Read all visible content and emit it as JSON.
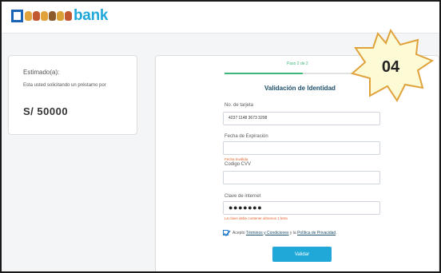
{
  "header": {
    "brand": "bank",
    "brand_colors": {
      "box": "#1b63b5",
      "text": "#1fa8d8"
    },
    "faces": [
      "#e2a23b",
      "#c2582f",
      "#e2a23b",
      "#8b5a2b",
      "#d9a035",
      "#c2582f"
    ]
  },
  "summary": {
    "title": "Estimado(a):",
    "text": "Esta usted solicitando un préstamo por",
    "amount": "S/ 50000"
  },
  "form": {
    "step": {
      "prefix": "Paso",
      "current": "2 de 2",
      "fraction": 0.5
    },
    "title": "Validación de Identidad",
    "card_number": {
      "label": "No. de tarjeta",
      "value": "4237 1148 3673 3208"
    },
    "expiration": {
      "label": "Fecha de Expiración",
      "value": "",
      "error": "Fecha Inválida"
    },
    "cvv": {
      "label": "Codigo CVV",
      "value": ""
    },
    "internet_key": {
      "label": "Clave de internet",
      "value": "●●●●●●●",
      "error": "La clave debe contener almenos 1 letra"
    },
    "terms": {
      "checked": true,
      "prefix": "Acepto",
      "link1": "Términos y Condiciones",
      "middle": "y la",
      "link2": "Política de Privacidad",
      "suffix": "."
    },
    "submit_label": "Validar"
  },
  "annotation": {
    "label": "04",
    "fill": "#fdfbd6",
    "stroke": "#e0a23a"
  }
}
